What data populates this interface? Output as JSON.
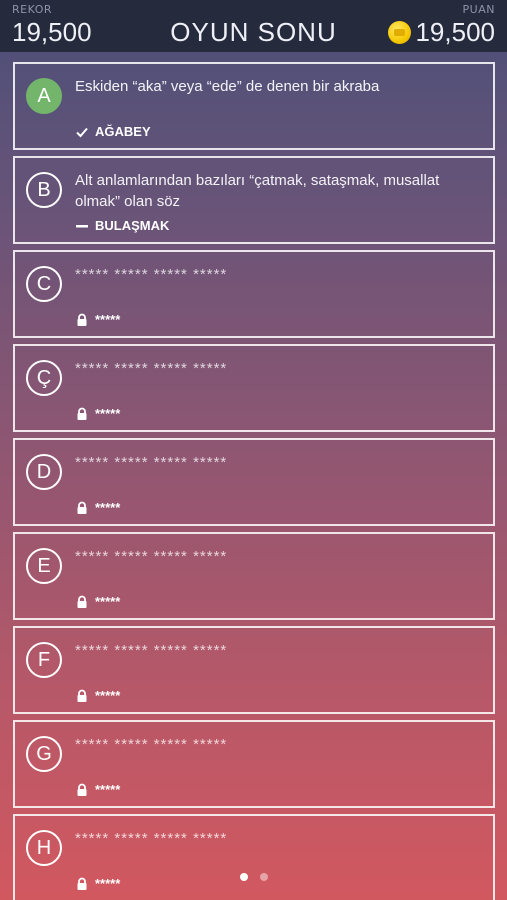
{
  "header": {
    "rekor_label": "REKOR",
    "rekor_value": "19,500",
    "title": "OYUN SONU",
    "puan_label": "PUAN",
    "puan_value": "19,500"
  },
  "colors": {
    "solved_badge": "#72b56b",
    "topbar": "#252a3d",
    "coin": "#f5c800"
  },
  "cards": [
    {
      "letter": "A",
      "question": "Eskiden “aka” veya “ede” de denen bir akraba",
      "answer": "AĞABEY",
      "status": "correct",
      "icon": "check-icon"
    },
    {
      "letter": "B",
      "question": "Alt anlamlarından bazıları “çatmak, sataşmak, musallat olmak” olan söz",
      "answer": "BULAŞMAK",
      "status": "skipped",
      "icon": "dash-icon"
    },
    {
      "letter": "C",
      "question": "***** ***** ***** *****",
      "answer": "*****",
      "status": "locked",
      "icon": "lock-icon"
    },
    {
      "letter": "Ç",
      "question": "***** ***** ***** *****",
      "answer": "*****",
      "status": "locked",
      "icon": "lock-icon"
    },
    {
      "letter": "D",
      "question": "***** ***** ***** *****",
      "answer": "*****",
      "status": "locked",
      "icon": "lock-icon"
    },
    {
      "letter": "E",
      "question": "***** ***** ***** *****",
      "answer": "*****",
      "status": "locked",
      "icon": "lock-icon"
    },
    {
      "letter": "F",
      "question": "***** ***** ***** *****",
      "answer": "*****",
      "status": "locked",
      "icon": "lock-icon"
    },
    {
      "letter": "G",
      "question": "***** ***** ***** *****",
      "answer": "*****",
      "status": "locked",
      "icon": "lock-icon"
    },
    {
      "letter": "H",
      "question": "***** ***** ***** *****",
      "answer": "*****",
      "status": "locked",
      "icon": "lock-icon"
    }
  ],
  "pagination": {
    "current": 1,
    "total": 2
  }
}
